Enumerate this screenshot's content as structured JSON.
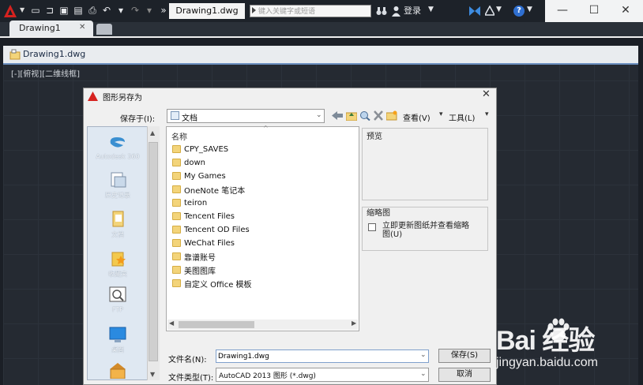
{
  "titlebar": {
    "file_title": "Drawing1.dwg",
    "search_placeholder": "键入关键字或短语",
    "login_label": "登录",
    "help_label": "?",
    "window_controls": {
      "minimize": "—",
      "maximize": "☐",
      "close": "✕"
    }
  },
  "tabs": {
    "document_tab": "Drawing1",
    "close": "✕"
  },
  "drawing": {
    "header_title": "Drawing1.dwg",
    "view_label": "[-][俯视][二维线框]"
  },
  "dialog": {
    "title": "图形另存为",
    "close": "✕",
    "save_in_label": "保存于(I):",
    "save_in_value": "文档",
    "view_menu": "查看(V)",
    "tools_menu": "工具(L)",
    "places": [
      {
        "label": "Autodesk 360",
        "icon": "cloud-icon"
      },
      {
        "label": "历史记录",
        "icon": "history-icon"
      },
      {
        "label": "文档",
        "icon": "documents-icon"
      },
      {
        "label": "收藏夹",
        "icon": "favorites-icon"
      },
      {
        "label": "FTP",
        "icon": "ftp-icon"
      },
      {
        "label": "桌面",
        "icon": "desktop-icon"
      }
    ],
    "column_header": "名称",
    "files": [
      "CPY_SAVES",
      "down",
      "My Games",
      "OneNote 笔记本",
      "teiron",
      "Tencent Files",
      "Tencent OD Files",
      "WeChat Files",
      "靠谱账号",
      "美图图库",
      "自定义 Office 模板"
    ],
    "preview_label": "预览",
    "thumbnail_label": "缩略图",
    "thumbnail_checkbox_label": "立即更新图纸并查看缩略图(U)",
    "thumbnail_checked": false,
    "filename_label": "文件名(N):",
    "filename_value": "Drawing1.dwg",
    "filetype_label": "文件类型(T):",
    "filetype_value": "AutoCAD 2013 图形 (*.dwg)",
    "save_button": "保存(S)",
    "cancel_button": "取消"
  },
  "watermark": {
    "logo": "Bai  经验",
    "url": "jingyan.baidu.com"
  },
  "colors": {
    "accent_blue": "#2f6fd1",
    "autocad_red": "#d6221f",
    "folder_yellow": "#f3d47a"
  }
}
